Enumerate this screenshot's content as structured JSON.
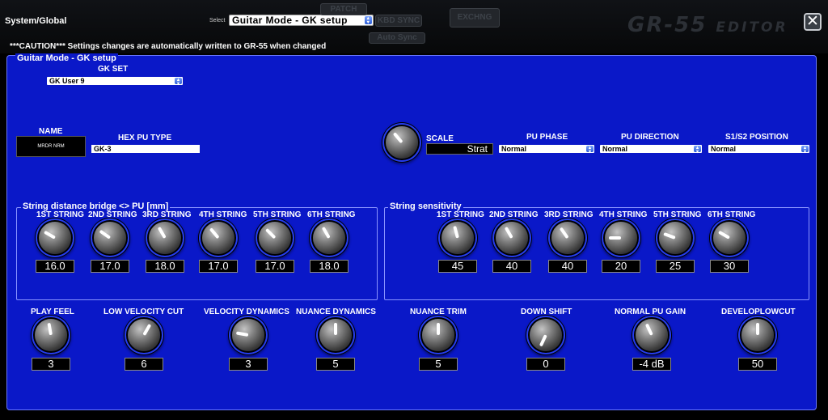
{
  "header": {
    "title": "System/Global",
    "select_label": "Select",
    "mode_value": "Guitar Mode - GK setup",
    "ghost_buttons": [
      "PATCH",
      "KBD SYNC",
      "EXCHNG",
      "Auto Sync"
    ],
    "logo_main": "GR-55",
    "logo_sub": "EDITOR",
    "close_symbol": "✕",
    "caution": "***CAUTION*** Settings changes are automatically written to GR-55 when changed"
  },
  "panel": {
    "title": "Guitar Mode - GK setup",
    "gk_set": {
      "label": "GK SET",
      "value": "GK User 9"
    },
    "name": {
      "label": "NAME",
      "value": "MRDR NRM"
    },
    "hex_pu_type": {
      "label": "HEX PU TYPE",
      "value": "GK-3"
    },
    "scale": {
      "label": "SCALE",
      "value": "Strat"
    },
    "pu_phase": {
      "label": "PU PHASE",
      "value": "Normal"
    },
    "pu_direction": {
      "label": "PU DIRECTION",
      "value": "Normal"
    },
    "s1s2_position": {
      "label": "S1/S2 POSITION",
      "value": "Normal"
    }
  },
  "string_distance": {
    "title": "String distance bridge <> PU [mm]",
    "knobs": [
      {
        "label": "1ST STRING",
        "value": "16.0",
        "angle": -60
      },
      {
        "label": "2ND STRING",
        "value": "17.0",
        "angle": -55
      },
      {
        "label": "3RD STRING",
        "value": "18.0",
        "angle": -30
      },
      {
        "label": "4TH STRING",
        "value": "17.0",
        "angle": -40
      },
      {
        "label": "5TH STRING",
        "value": "17.0",
        "angle": -45
      },
      {
        "label": "6TH STRING",
        "value": "18.0",
        "angle": -30
      }
    ]
  },
  "string_sensitivity": {
    "title": "String sensitivity",
    "knobs": [
      {
        "label": "1ST STRING",
        "value": "45",
        "angle": -15
      },
      {
        "label": "2ND STRING",
        "value": "40",
        "angle": -30
      },
      {
        "label": "3RD STRING",
        "value": "40",
        "angle": -35
      },
      {
        "label": "4TH STRING",
        "value": "20",
        "angle": -90
      },
      {
        "label": "5TH STRING",
        "value": "25",
        "angle": -70
      },
      {
        "label": "6TH STRING",
        "value": "30",
        "angle": -60
      }
    ]
  },
  "bottom_knobs": [
    {
      "label": "PLAY FEEL",
      "value": "3",
      "angle": -10
    },
    {
      "label": "LOW VELOCITY CUT",
      "value": "6",
      "angle": 30
    },
    {
      "label": "VELOCITY DYNAMICS",
      "value": "3",
      "angle": -80
    },
    {
      "label": "NUANCE DYNAMICS",
      "value": "5",
      "angle": 0
    },
    {
      "label": "NUANCE TRIM",
      "value": "5",
      "angle": 0
    },
    {
      "label": "DOWN SHIFT",
      "value": "0",
      "angle": -155
    },
    {
      "label": "NORMAL PU GAIN",
      "value": "-4 dB",
      "angle": -25
    },
    {
      "label": "DEVELOPLOWCUT",
      "value": "50",
      "angle": 0
    }
  ]
}
